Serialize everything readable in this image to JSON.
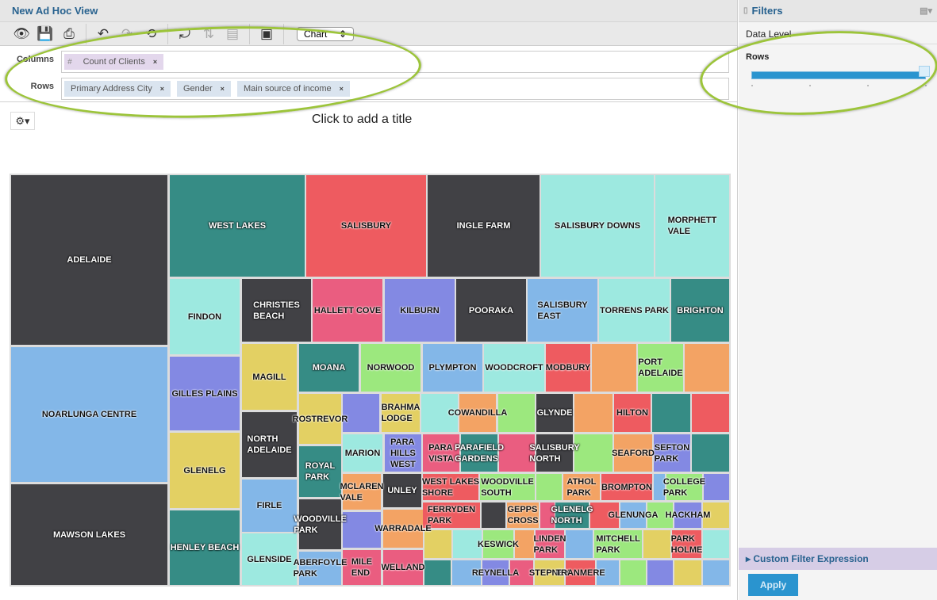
{
  "app": {
    "title": "New Ad Hoc View",
    "view_type": "Chart"
  },
  "toolbar": {
    "icons": [
      "eye-icon",
      "save-icon",
      "export-icon",
      "undo-icon",
      "redo-icon",
      "undo-all-icon",
      "switch-axes-icon",
      "sort-icon",
      "layout-icon",
      "display-options-icon"
    ]
  },
  "columns": {
    "label": "Columns",
    "type_marker": "#",
    "pills": [
      "Count of Clients"
    ]
  },
  "rows": {
    "label": "Rows",
    "pills": [
      "Primary Address City",
      "Gender",
      "Main source of income"
    ]
  },
  "remove_glyph": "×",
  "chart": {
    "title_placeholder": "Click to add a title"
  },
  "filters": {
    "title": "Filters",
    "data_level": "Data Level",
    "rows_label": "Rows",
    "slider_value_fraction": 1.0,
    "custom_filter": "Custom Filter Expression",
    "apply": "Apply"
  },
  "palette": {
    "dark": "#414145",
    "teal": "#368c85",
    "red": "#ee5b60",
    "cyan": "#9de9e0",
    "blue": "#83b7e8",
    "pink": "#ea5d80",
    "purple": "#8389e3",
    "yellow": "#e3d063",
    "green": "#9ce87e",
    "orange": "#f3a364"
  },
  "chart_data": {
    "type": "treemap",
    "tiles": [
      {
        "label": "ADELAIDE",
        "color": "dark"
      },
      {
        "label": "NOARLUNGA CENTRE",
        "color": "blue"
      },
      {
        "label": "MAWSON LAKES",
        "color": "dark"
      },
      {
        "label": "WEST LAKES",
        "color": "teal"
      },
      {
        "label": "SALISBURY",
        "color": "red"
      },
      {
        "label": "INGLE FARM",
        "color": "dark"
      },
      {
        "label": "SALISBURY DOWNS",
        "color": "cyan"
      },
      {
        "label": "MORPHETT\nVALE",
        "color": "cyan"
      },
      {
        "label": "FINDON",
        "color": "cyan"
      },
      {
        "label": "GILLES PLAINS",
        "color": "purple"
      },
      {
        "label": "GLENELG",
        "color": "yellow"
      },
      {
        "label": "HENLEY BEACH",
        "color": "teal"
      },
      {
        "label": "CHRISTIES\nBEACH",
        "color": "dark"
      },
      {
        "label": "HALLETT COVE",
        "color": "pink"
      },
      {
        "label": "KILBURN",
        "color": "purple"
      },
      {
        "label": "POORAKA",
        "color": "dark"
      },
      {
        "label": "SALISBURY\nEAST",
        "color": "blue"
      },
      {
        "label": "TORRENS PARK",
        "color": "cyan"
      },
      {
        "label": "BRIGHTON",
        "color": "teal"
      },
      {
        "label": "MAGILL",
        "color": "yellow"
      },
      {
        "label": "MOANA",
        "color": "teal"
      },
      {
        "label": "NORWOOD",
        "color": "green"
      },
      {
        "label": "PLYMPTON",
        "color": "blue"
      },
      {
        "label": "WOODCROFT",
        "color": "cyan"
      },
      {
        "label": "MODBURY",
        "color": "red"
      },
      {
        "label": "",
        "color": "orange"
      },
      {
        "label": "PORT\nADELAIDE",
        "color": "green"
      },
      {
        "label": "",
        "color": "orange"
      },
      {
        "label": "NORTH\nADELAIDE",
        "color": "dark"
      },
      {
        "label": "ROSTREVOR",
        "color": "yellow"
      },
      {
        "label": "",
        "color": "purple"
      },
      {
        "label": "BRAHMA\nLODGE",
        "color": "yellow"
      },
      {
        "label": "",
        "color": "cyan"
      },
      {
        "label": "COWANDILLA",
        "color": "orange"
      },
      {
        "label": "",
        "color": "green"
      },
      {
        "label": "GLYNDE",
        "color": "dark"
      },
      {
        "label": "",
        "color": "orange"
      },
      {
        "label": "HILTON",
        "color": "red"
      },
      {
        "label": "",
        "color": "teal"
      },
      {
        "label": "",
        "color": "red"
      },
      {
        "label": "ROYAL\nPARK",
        "color": "teal"
      },
      {
        "label": "MARION",
        "color": "cyan"
      },
      {
        "label": "PARA\nHILLS\nWEST",
        "color": "purple"
      },
      {
        "label": "PARA\nVISTA",
        "color": "pink"
      },
      {
        "label": "PARAFIELD\nGARDENS",
        "color": "teal"
      },
      {
        "label": "",
        "color": "pink"
      },
      {
        "label": "SALISBURY\nNORTH",
        "color": "dark"
      },
      {
        "label": "",
        "color": "green"
      },
      {
        "label": "SEAFORD",
        "color": "orange"
      },
      {
        "label": "SEFTON\nPARK",
        "color": "purple"
      },
      {
        "label": "",
        "color": "teal"
      },
      {
        "label": "FIRLE",
        "color": "blue"
      },
      {
        "label": "GLENSIDE",
        "color": "cyan"
      },
      {
        "label": "WOODVILLE\nPARK",
        "color": "dark"
      },
      {
        "label": "ABERFOYLE\nPARK",
        "color": "blue"
      },
      {
        "label": "MCLAREN\nVALE",
        "color": "orange"
      },
      {
        "label": "",
        "color": "purple"
      },
      {
        "label": "MILE\nEND",
        "color": "pink"
      },
      {
        "label": "UNLEY",
        "color": "dark"
      },
      {
        "label": "WARRADALE",
        "color": "orange"
      },
      {
        "label": "WELLAND",
        "color": "pink"
      },
      {
        "label": "WEST LAKES\nSHORE",
        "color": "red"
      },
      {
        "label": "WOODVILLE\nSOUTH",
        "color": "green"
      },
      {
        "label": "",
        "color": "green"
      },
      {
        "label": "ATHOL\nPARK",
        "color": "orange"
      },
      {
        "label": "BROMPTON",
        "color": "red"
      },
      {
        "label": "",
        "color": "blue"
      },
      {
        "label": "COLLEGE\nPARK",
        "color": "green"
      },
      {
        "label": "",
        "color": "purple"
      },
      {
        "label": "FERRYDEN\nPARK",
        "color": "red"
      },
      {
        "label": "",
        "color": "dark"
      },
      {
        "label": "GEPPS\nCROSS",
        "color": "orange"
      },
      {
        "label": "",
        "color": "pink"
      },
      {
        "label": "GLENELG\nNORTH",
        "color": "teal"
      },
      {
        "label": "",
        "color": "red"
      },
      {
        "label": "GLENUNGA",
        "color": "blue"
      },
      {
        "label": "",
        "color": "green"
      },
      {
        "label": "HACKHAM",
        "color": "purple"
      },
      {
        "label": "",
        "color": "yellow"
      },
      {
        "label": "",
        "color": "yellow"
      },
      {
        "label": "",
        "color": "cyan"
      },
      {
        "label": "KESWICK",
        "color": "green"
      },
      {
        "label": "",
        "color": "orange"
      },
      {
        "label": "LINDEN\nPARK",
        "color": "pink"
      },
      {
        "label": "",
        "color": "blue"
      },
      {
        "label": "MITCHELL\nPARK",
        "color": "green"
      },
      {
        "label": "",
        "color": "yellow"
      },
      {
        "label": "PARK\nHOLME",
        "color": "red"
      },
      {
        "label": "",
        "color": "cyan"
      },
      {
        "label": "",
        "color": "teal"
      },
      {
        "label": "",
        "color": "blue"
      },
      {
        "label": "REYNELLA",
        "color": "purple"
      },
      {
        "label": "",
        "color": "pink"
      },
      {
        "label": "STEPNEY",
        "color": "yellow"
      },
      {
        "label": "TRANMERE",
        "color": "red"
      },
      {
        "label": "",
        "color": "blue"
      },
      {
        "label": "",
        "color": "green"
      },
      {
        "label": "",
        "color": "purple"
      },
      {
        "label": "",
        "color": "yellow"
      },
      {
        "label": "",
        "color": "blue"
      }
    ]
  }
}
